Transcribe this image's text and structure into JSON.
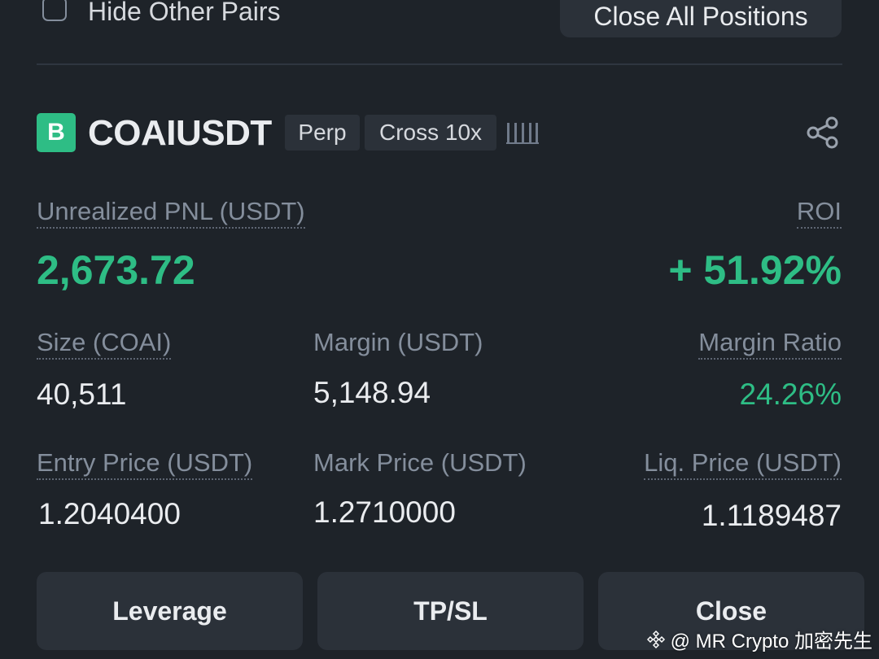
{
  "top": {
    "hide_other_pairs_label": "Hide Other Pairs",
    "close_all_label": "Close All Positions"
  },
  "position": {
    "side_badge": "B",
    "symbol": "COAIUSDT",
    "contract_type": "Perp",
    "margin_mode": "Cross 10x",
    "unrealized_pnl_label": "Unrealized PNL (USDT)",
    "unrealized_pnl_value": "2,673.72",
    "roi_label": "ROI",
    "roi_value": "+ 51.92%",
    "size_label": "Size (COAI)",
    "size_value": "40,511",
    "margin_label": "Margin (USDT)",
    "margin_value": "5,148.94",
    "margin_ratio_label": "Margin Ratio",
    "margin_ratio_value": "24.26%",
    "entry_price_label": "Entry Price (USDT)",
    "entry_price_value": "1.2040400",
    "mark_price_label": "Mark Price (USDT)",
    "mark_price_value": "1.2710000",
    "liq_price_label": "Liq. Price (USDT)",
    "liq_price_value": "1.1189487"
  },
  "actions": {
    "leverage_label": "Leverage",
    "tpsl_label": "TP/SL",
    "close_label": "Close"
  },
  "watermark": {
    "text": "@ MR Crypto 加密先生"
  },
  "colors": {
    "background": "#1e2329",
    "panel": "#2b3139",
    "positive": "#2ebd85",
    "muted": "#848e9c",
    "text": "#eaecef"
  },
  "icons": {
    "share": "share-icon",
    "signal": "signal-bars-icon",
    "checkbox": "checkbox-unchecked-icon",
    "logo": "binance-logo-icon"
  }
}
